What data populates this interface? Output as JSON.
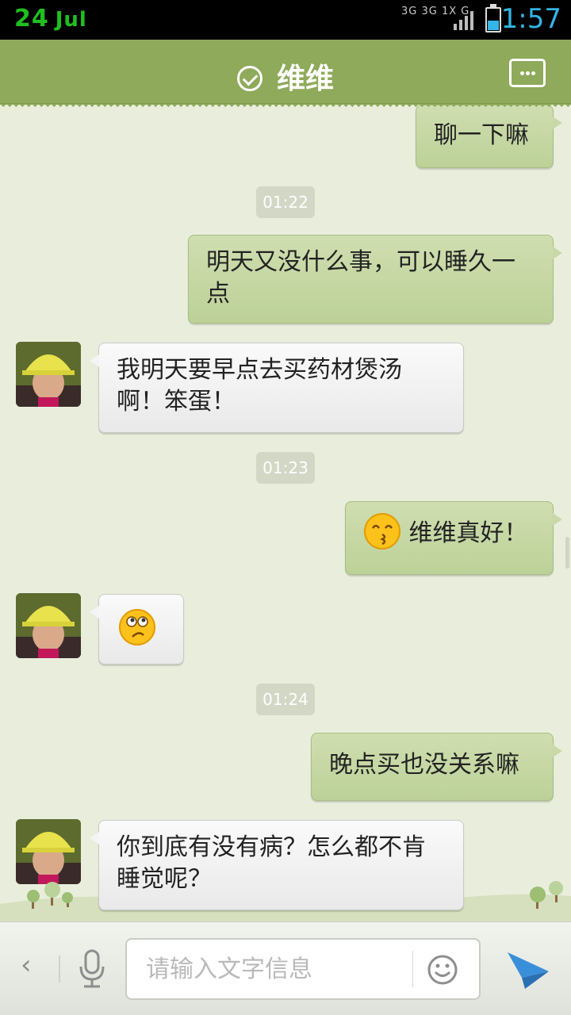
{
  "status_bar": {
    "date_day": "24",
    "date_month": "Jul",
    "network_top": "3G 3G 1X G",
    "time": "1:57",
    "battery_icon": "battery-icon",
    "signal_icon": "signal-icon"
  },
  "header": {
    "title": "维维",
    "verified_icon": "check-circle-icon",
    "more_icon": "more-icon",
    "bg_color": "#8eaa5a"
  },
  "messages": [
    {
      "type": "me",
      "text": "聊一下嘛"
    },
    {
      "type": "time",
      "text": "01:22"
    },
    {
      "type": "me",
      "text": "明天又没什么事，可以睡久一点"
    },
    {
      "type": "other",
      "text": "我明天要早点去买药材煲汤啊！笨蛋！",
      "avatar": "avatar"
    },
    {
      "type": "time",
      "text": "01:23"
    },
    {
      "type": "me",
      "text": "维维真好！",
      "emoji": "kiss-emoji-icon"
    },
    {
      "type": "other",
      "text": "",
      "emoji": "confused-emoji-icon",
      "avatar": "avatar"
    },
    {
      "type": "time",
      "text": "01:24"
    },
    {
      "type": "me",
      "text": "晚点买也没关系嘛"
    },
    {
      "type": "other",
      "text": "你到底有没有病？怎么都不肯睡觉呢？",
      "avatar": "avatar"
    }
  ],
  "input_bar": {
    "placeholder": "请输入文字信息",
    "back_label": "‹",
    "mic_icon": "microphone-icon",
    "emoji_icon": "smiley-icon",
    "send_icon": "send-icon"
  },
  "colors": {
    "my_bubble": "#c4d6a2",
    "other_bubble": "#f2f2f2",
    "chat_bg": "#e9eedc",
    "time_accent": "#33b5e5"
  }
}
